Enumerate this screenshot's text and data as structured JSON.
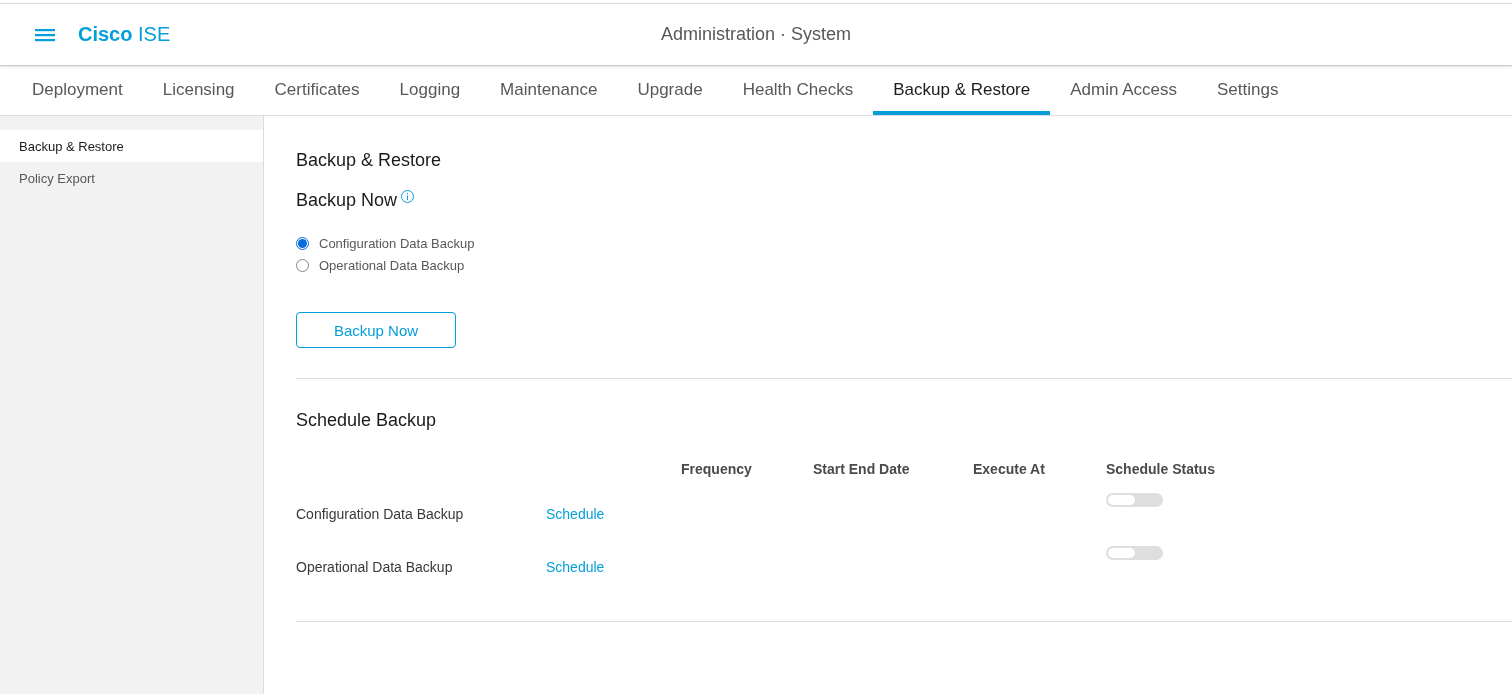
{
  "header": {
    "logo": "**Cisco** ISE",
    "title": "Administration · System"
  },
  "tabs": [
    {
      "label": "Deployment",
      "selected": false
    },
    {
      "label": "Licensing",
      "selected": false
    },
    {
      "label": "Certificates",
      "selected": false
    },
    {
      "label": "Logging",
      "selected": false
    },
    {
      "label": "Maintenance",
      "selected": false
    },
    {
      "label": "Upgrade",
      "selected": false
    },
    {
      "label": "Health Checks",
      "selected": false
    },
    {
      "label": "Backup & Restore",
      "selected": true
    },
    {
      "label": "Admin Access",
      "selected": false
    },
    {
      "label": "Settings",
      "selected": false
    }
  ],
  "sidebar": {
    "items": [
      {
        "label": "Backup & Restore",
        "selected": true
      },
      {
        "label": "Policy Export",
        "selected": false
      }
    ]
  },
  "page_title": "Backup & Restore",
  "backup_now": {
    "heading": "Backup Now",
    "options": [
      {
        "label": "Configuration Data Backup",
        "selected": true
      },
      {
        "label": "Operational Data Backup",
        "selected": false
      }
    ],
    "button": "Backup Now"
  },
  "schedule_backup": {
    "heading": "Schedule Backup",
    "columns": [
      "Frequency",
      "Start End Date",
      "Execute At",
      "Schedule Status"
    ],
    "rows": [
      {
        "label": "Configuration Data Backup",
        "action": "Schedule",
        "on": false
      },
      {
        "label": "Operational Data Backup",
        "action": "Schedule",
        "on": false
      }
    ]
  }
}
